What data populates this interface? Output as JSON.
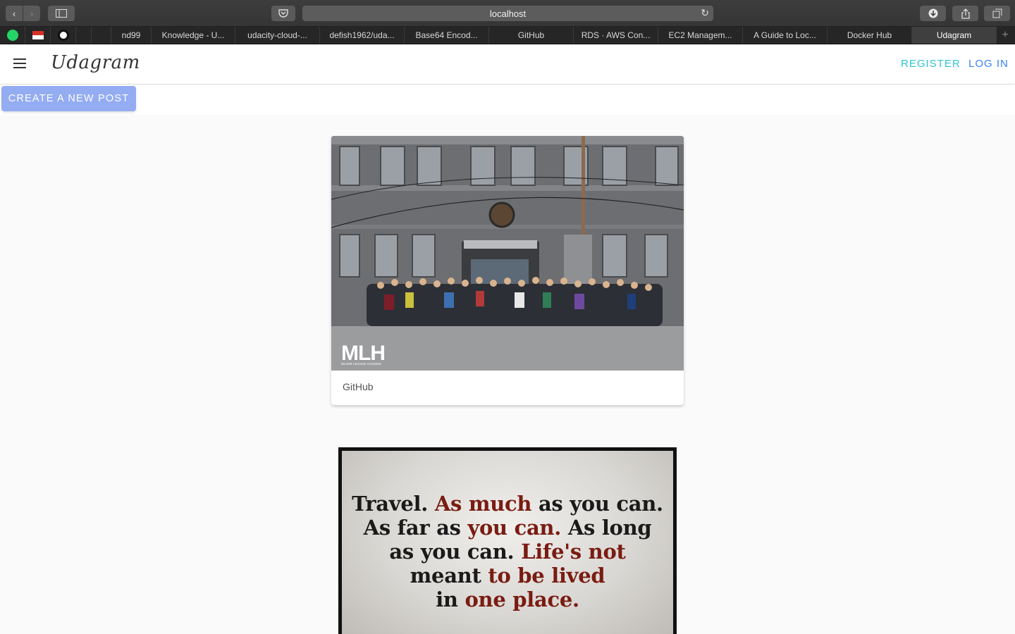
{
  "browser": {
    "url": "localhost",
    "tabs": [
      {
        "label": "nd99"
      },
      {
        "label": "Knowledge - U..."
      },
      {
        "label": "udacity-cloud-..."
      },
      {
        "label": "defish1962/uda..."
      },
      {
        "label": "Base64 Encod..."
      },
      {
        "label": "GitHub"
      },
      {
        "label": "RDS · AWS Con..."
      },
      {
        "label": "EC2 Managem..."
      },
      {
        "label": "A Guide to Loc..."
      },
      {
        "label": "Docker Hub"
      },
      {
        "label": "Udagram"
      }
    ],
    "active_tab": "Udagram"
  },
  "header": {
    "brand": "Udagram",
    "register_label": "REGISTER",
    "login_label": "LOG IN"
  },
  "actions": {
    "create_post_label": "CREATE A NEW POST"
  },
  "feed": [
    {
      "caption": "GitHub",
      "image_logo": "MLH",
      "image_logo_sub": "MAJOR LEAGUE HACKING"
    },
    {
      "quote_lines": [
        [
          "Travel. ",
          "As much ",
          "as you can."
        ],
        [
          "As far as ",
          "you can. ",
          "As long"
        ],
        [
          "as you can. ",
          "Life's not"
        ],
        [
          "meant ",
          "to be lived"
        ],
        [
          "in ",
          "one place."
        ]
      ]
    }
  ],
  "colors": {
    "accent": "#3880ff",
    "register": "#2ec4d6",
    "create_button": "#93acf2"
  }
}
